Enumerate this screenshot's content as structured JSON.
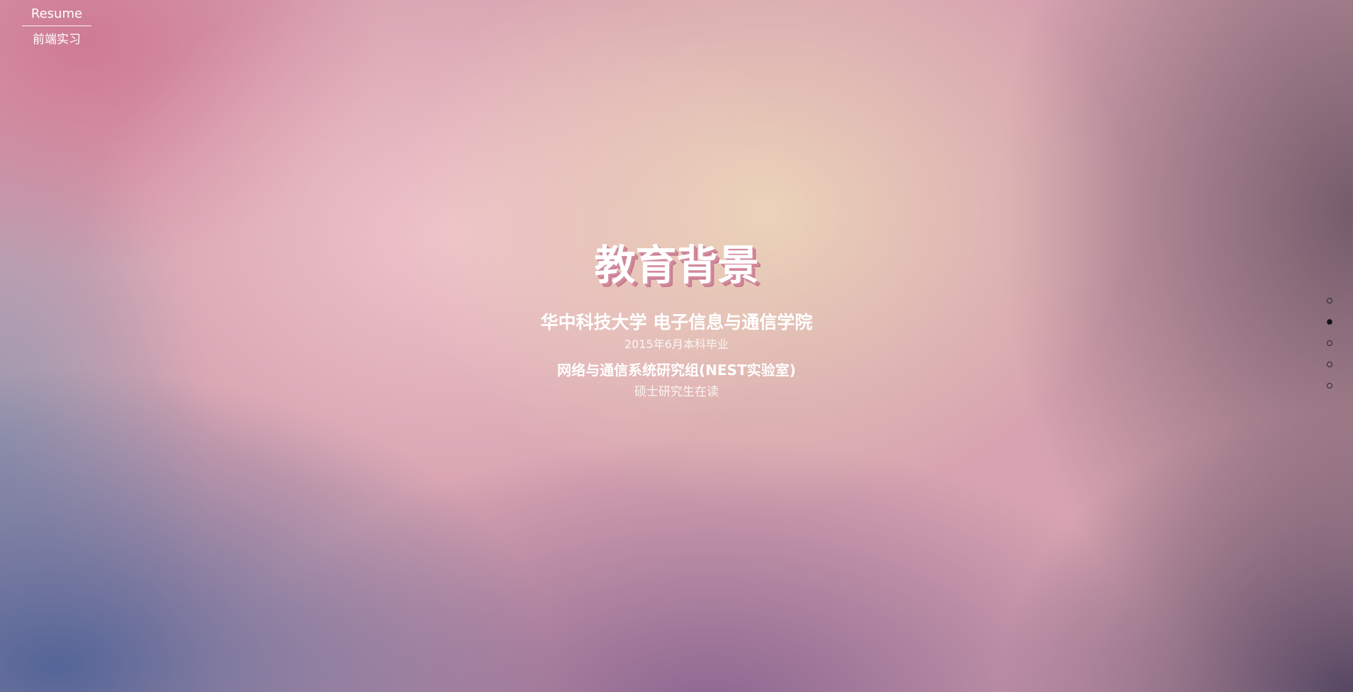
{
  "brand": {
    "title": "Resume",
    "subtitle": "前端实习"
  },
  "section": {
    "title": "教育背景",
    "university": "华中科技大学 电子信息与通信学院",
    "graduation": "2015年6月本科毕业",
    "lab": "网络与通信系统研究组(NEST实验室)",
    "status": "硕士研究生在读"
  },
  "nav": {
    "dots": 5,
    "active_index": 1
  },
  "colors": {
    "text": "#ffffff",
    "title_shadow": "#d28a9c",
    "dot_active": "#111111"
  }
}
